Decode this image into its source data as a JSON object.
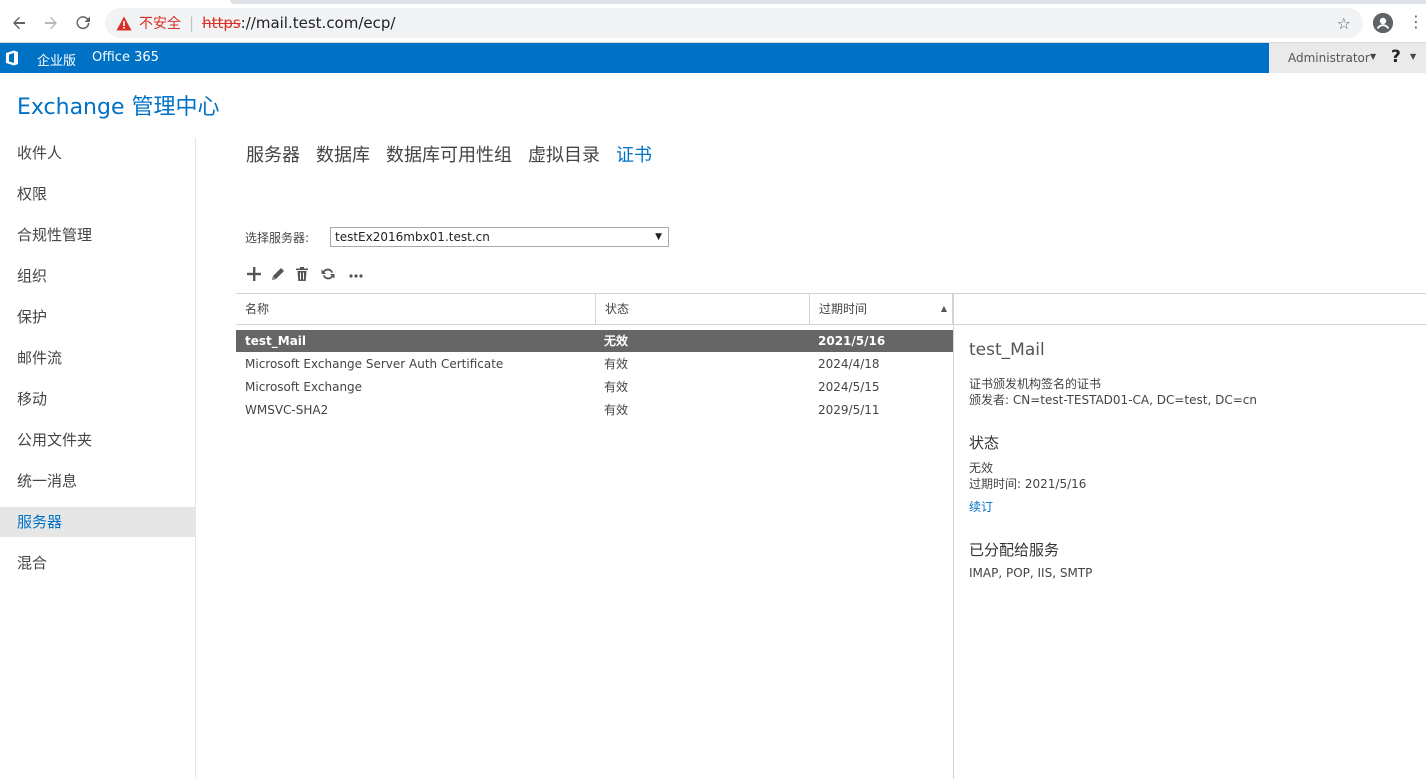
{
  "browser": {
    "security_label": "不安全",
    "url_scheme": "https",
    "url_rest": "://mail.test.com/ecp/"
  },
  "o365": {
    "edition": "企业版",
    "product": "Office 365",
    "user": "Administrator",
    "help": "?"
  },
  "app_title": "Exchange 管理中心",
  "nav": {
    "items": [
      {
        "label": "收件人"
      },
      {
        "label": "权限"
      },
      {
        "label": "合规性管理"
      },
      {
        "label": "组织"
      },
      {
        "label": "保护"
      },
      {
        "label": "邮件流"
      },
      {
        "label": "移动"
      },
      {
        "label": "公用文件夹"
      },
      {
        "label": "统一消息"
      },
      {
        "label": "服务器",
        "selected": true
      },
      {
        "label": "混合"
      }
    ]
  },
  "tabs": [
    {
      "label": "服务器"
    },
    {
      "label": "数据库"
    },
    {
      "label": "数据库可用性组"
    },
    {
      "label": "虚拟目录"
    },
    {
      "label": "证书",
      "active": true
    }
  ],
  "server_select": {
    "label": "选择服务器:",
    "value": "testEx2016mbx01.test.cn"
  },
  "toolbar": {
    "add": "add-icon",
    "edit": "edit-icon",
    "delete": "delete-icon",
    "refresh": "refresh-icon",
    "more": "more-icon"
  },
  "table": {
    "columns": [
      "名称",
      "状态",
      "过期时间"
    ],
    "rows": [
      {
        "name": "test_Mail",
        "status": "无效",
        "expires": "2021/5/16",
        "selected": true
      },
      {
        "name": "Microsoft Exchange Server Auth Certificate",
        "status": "有效",
        "expires": "2024/4/18"
      },
      {
        "name": "Microsoft Exchange",
        "status": "有效",
        "expires": "2024/5/15"
      },
      {
        "name": "WMSVC-SHA2",
        "status": "有效",
        "expires": "2029/5/11"
      }
    ]
  },
  "details": {
    "title": "test_Mail",
    "cert_type": "证书颁发机构签名的证书",
    "issuer": "颁发者: CN=test-TESTAD01-CA, DC=test, DC=cn",
    "status_heading": "状态",
    "status_value": "无效",
    "expiry": "过期时间: 2021/5/16",
    "renew_link": "续订",
    "services_heading": "已分配给服务",
    "services_value": "IMAP, POP, IIS, SMTP"
  },
  "colors": {
    "accent": "#0072c6",
    "selected_row": "#666666",
    "warning": "#d93025"
  }
}
